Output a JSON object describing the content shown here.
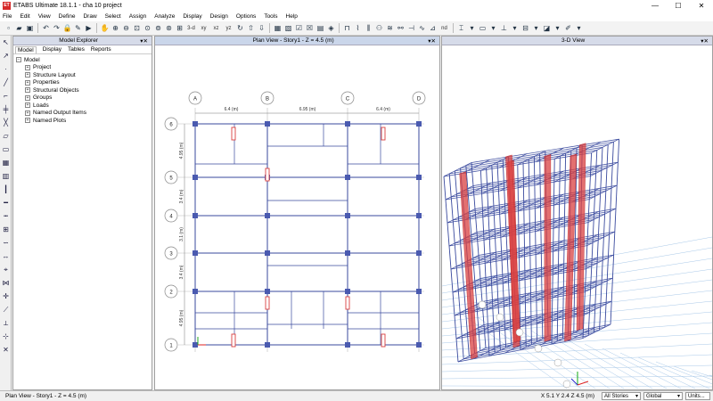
{
  "window": {
    "title": "ETABS Ultimate 18.1.1 - cha 10 project",
    "logo": "ET",
    "min": "—",
    "max": "☐",
    "close": "✕"
  },
  "menu": [
    "File",
    "Edit",
    "View",
    "Define",
    "Draw",
    "Select",
    "Assign",
    "Analyze",
    "Display",
    "Design",
    "Options",
    "Tools",
    "Help"
  ],
  "toolbar": {
    "view_3d": "3-d",
    "view_xy": "xy",
    "view_xz": "xz",
    "view_yz": "yz",
    "view_nd": "nd"
  },
  "explorer": {
    "title": "Model Explorer",
    "tabs": [
      "Model",
      "Display",
      "Tables",
      "Reports"
    ],
    "root": "Model",
    "items": [
      "Project",
      "Structure Layout",
      "Properties",
      "Structural Objects",
      "Groups",
      "Loads",
      "Named Output Items",
      "Named Plots"
    ]
  },
  "plan": {
    "title": "Plan View - Story1 - Z = 4.5 (m)",
    "grid_x_labels": [
      "A",
      "B",
      "C",
      "D"
    ],
    "grid_y_labels": [
      "6",
      "5",
      "4",
      "3",
      "2",
      "1"
    ],
    "x_dims": [
      "6.4 (m)",
      "6.95 (m)",
      "6.4 (m)"
    ],
    "y_dims": [
      "4.95 (m)",
      "3.4 (m)",
      "3.1 (m)",
      "3.4 (m)",
      "4.95 (m)"
    ]
  },
  "view3d": {
    "title": "3-D View"
  },
  "status": {
    "left": "Plan View - Story1 - Z = 4.5 (m)",
    "coords": "X 5.1  Y 2.4  Z 4.5 (m)",
    "stories": "All Stories",
    "coord_system": "Global",
    "units": "Units..."
  },
  "colors": {
    "frame": "#3a4a9e",
    "wall": "#d94040",
    "column": "#4a5ab0",
    "grid": "#a8c8e8"
  }
}
